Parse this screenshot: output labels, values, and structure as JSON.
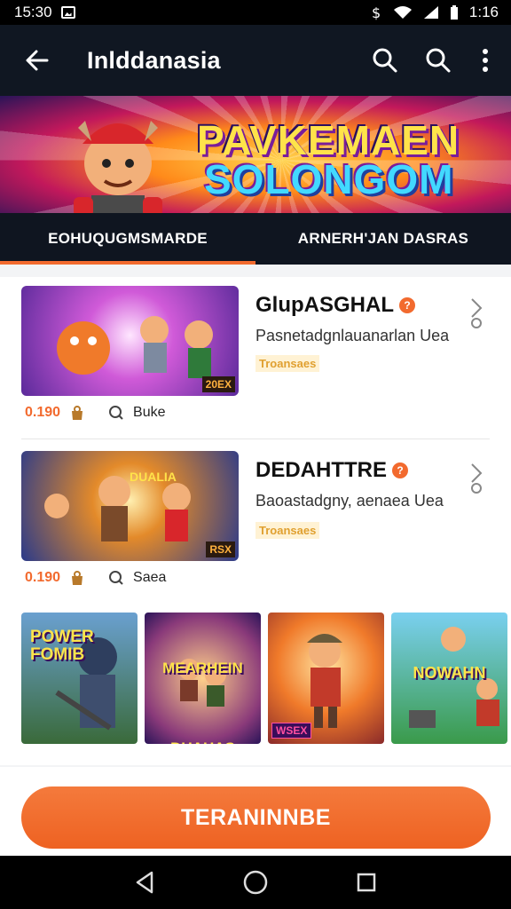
{
  "status_bar": {
    "time": "15:30",
    "right_text": "1:16"
  },
  "app_bar": {
    "title": "Inlddanasia"
  },
  "banner": {
    "line1": "PAVKEMAEN",
    "line2": "SOLONGOM"
  },
  "tabs": [
    {
      "label": "EOHUQUGMSMARDE",
      "active": true
    },
    {
      "label": "ARNERH'JAN DASRAS",
      "active": false
    }
  ],
  "items": [
    {
      "title": "GlupASGHAL",
      "subtitle": "Pasnetadgnlauanarlan Uea",
      "tag": "Troansaes",
      "price": "0.190",
      "label": "Buke",
      "thumb_badge": "20EX"
    },
    {
      "title": "DEDAHTTRE",
      "subtitle": "Baoastadgny, aenaea Uea",
      "tag": "Troansaes",
      "price": "0.190",
      "label": "Saea",
      "thumb_badge": "RSX"
    }
  ],
  "grid": [
    {
      "text": "POWER FOMIB",
      "badge": ""
    },
    {
      "text": "MEARHEIN DUAHAS",
      "badge": ""
    },
    {
      "text": "",
      "badge": "WSEX"
    },
    {
      "text": "NOWAHN",
      "badge": ""
    }
  ],
  "cta": {
    "label": "TERANINNBE"
  },
  "colors": {
    "accent": "#f26a2e",
    "header_bg": "#101722",
    "tab_bg": "#0f1520"
  }
}
